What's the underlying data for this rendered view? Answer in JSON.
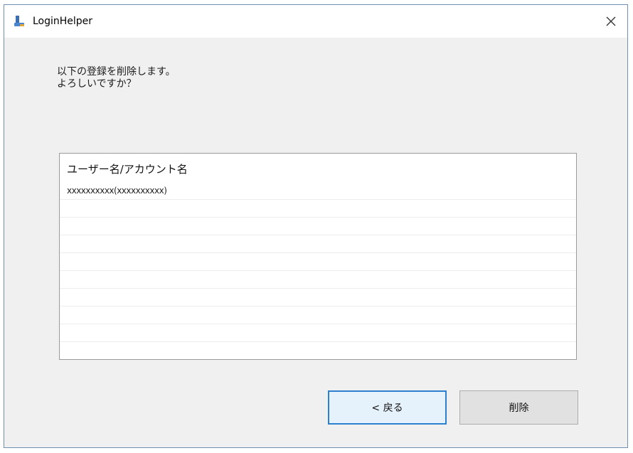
{
  "window": {
    "title": "LoginHelper",
    "close_symbol": "×"
  },
  "message": {
    "line1": "以下の登録を削除します。",
    "line2": "よろしいですか？"
  },
  "list": {
    "header": "ユーザー名/アカウント名",
    "rows": [
      "xxxxxxxxxx(xxxxxxxxxx)",
      "",
      "",
      "",
      "",
      "",
      "",
      "",
      "",
      ""
    ]
  },
  "buttons": {
    "back_label": "< 戻る",
    "delete_label": "削除"
  },
  "icons": {
    "app": "login-helper-app-icon",
    "close": "close-icon"
  },
  "colors": {
    "accent": "#2d7fd0",
    "window_border": "#6f8fb3",
    "dialog_bg": "#f0f0f0"
  }
}
